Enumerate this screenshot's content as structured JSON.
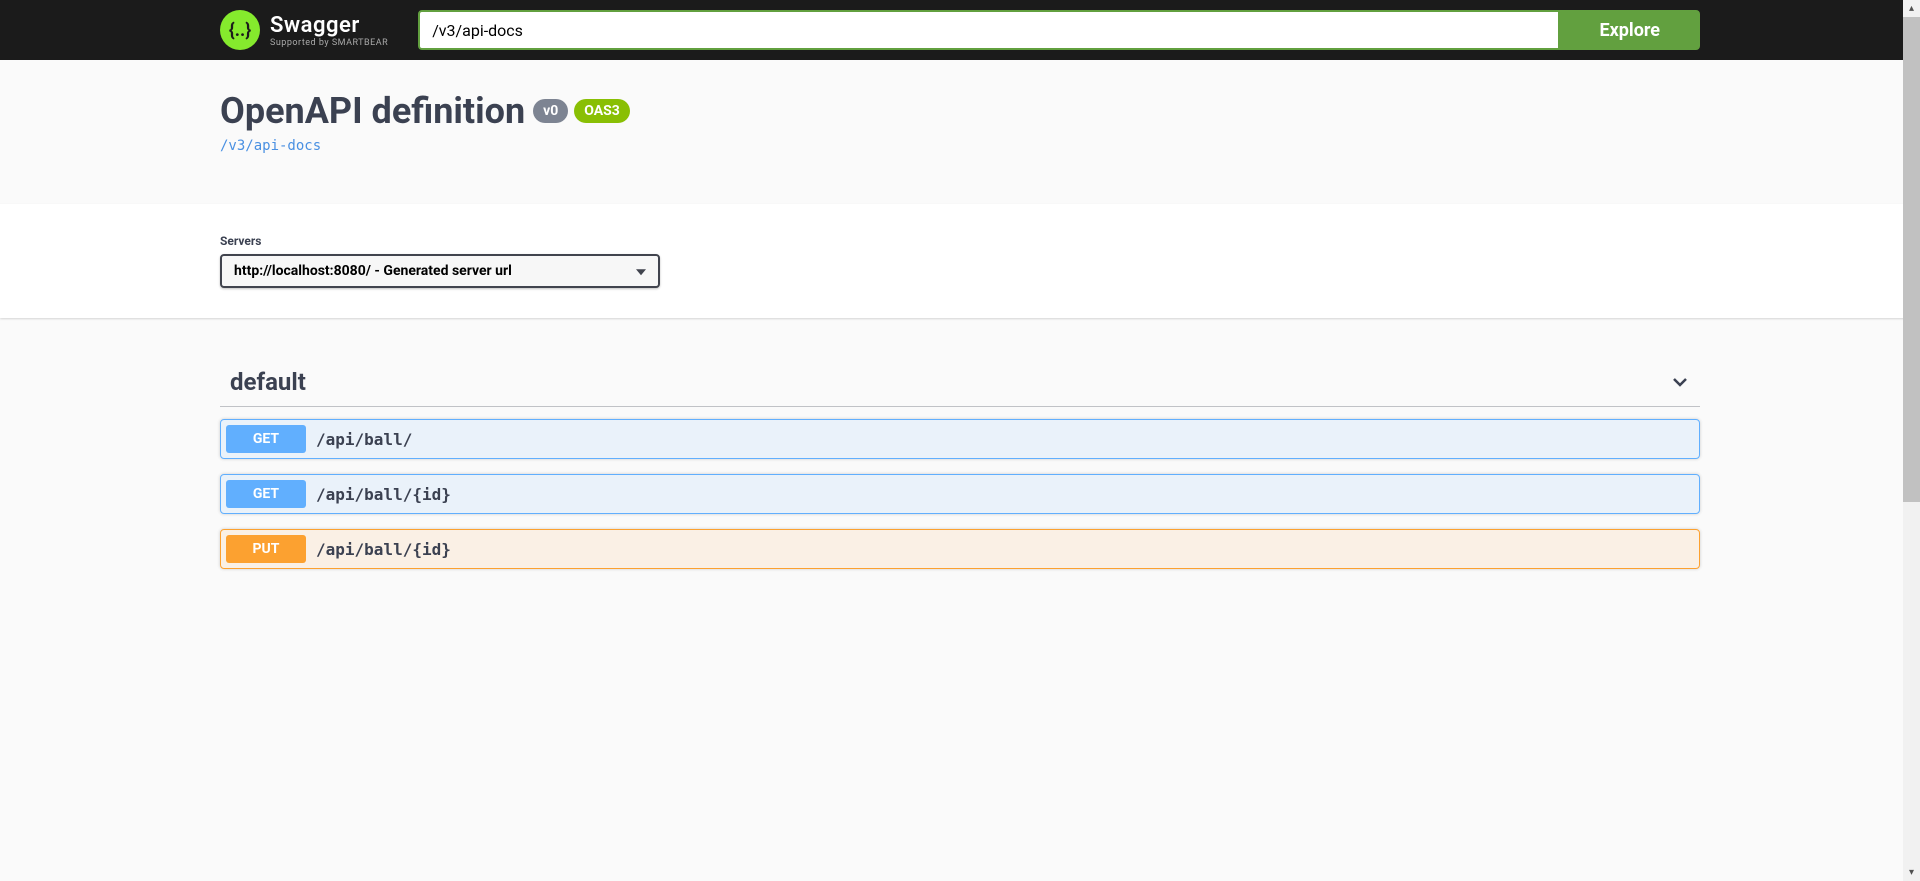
{
  "topbar": {
    "logo_main": "Swagger",
    "logo_sub": "Supported by SMARTBEAR",
    "url_input_value": "/v3/api-docs",
    "explore_label": "Explore"
  },
  "info": {
    "title": "OpenAPI definition",
    "version_badge": "v0",
    "oas_badge": "OAS3",
    "api_docs_link": "/v3/api-docs"
  },
  "servers": {
    "label": "Servers",
    "selected": "http://localhost:8080/ - Generated server url"
  },
  "tag": {
    "name": "default"
  },
  "operations": [
    {
      "method": "GET",
      "method_class": "get",
      "path": "/api/ball/"
    },
    {
      "method": "GET",
      "method_class": "get",
      "path": "/api/ball/{id}"
    },
    {
      "method": "PUT",
      "method_class": "put",
      "path": "/api/ball/{id}"
    }
  ]
}
